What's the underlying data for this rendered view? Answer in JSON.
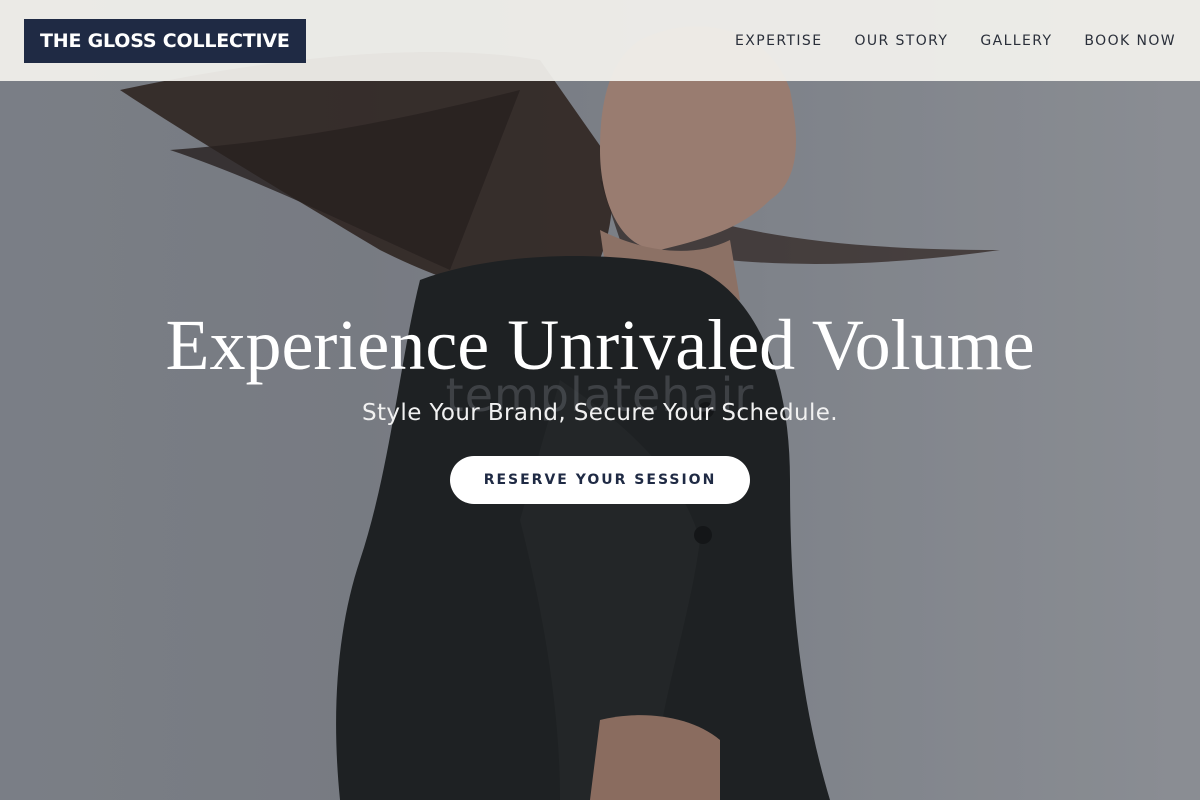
{
  "header": {
    "logo": "THE GLOSS COLLECTIVE",
    "nav": [
      {
        "label": "EXPERTISE"
      },
      {
        "label": "OUR STORY"
      },
      {
        "label": "GALLERY"
      },
      {
        "label": "BOOK NOW"
      }
    ]
  },
  "hero": {
    "title": "Experience Unrivaled Volume",
    "subtitle": "Style Your Brand, Secure Your Schedule.",
    "watermark": "templatehair",
    "cta_label": "RESERVE YOUR SESSION"
  },
  "colors": {
    "brand_navy": "#1f2a44",
    "header_bg": "#f3f2ee",
    "cta_bg": "#ffffff"
  }
}
